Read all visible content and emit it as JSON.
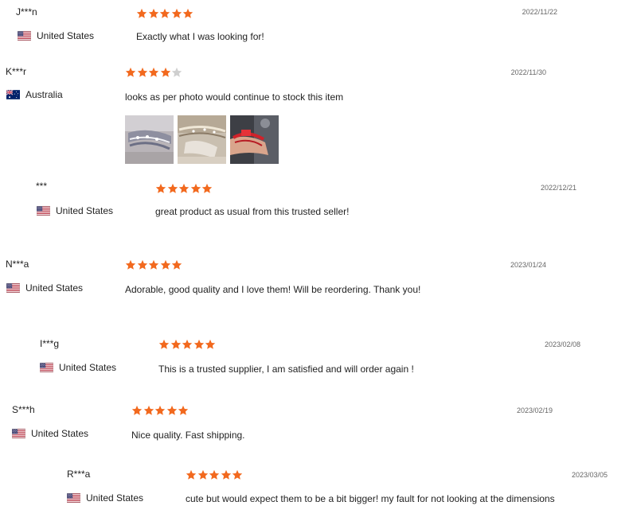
{
  "colors": {
    "star_filled": "#f2691e",
    "star_empty": "#cfcfcf",
    "date_text": "#666666"
  },
  "icons": {
    "star": "star-icon",
    "flag_us": "us-flag-icon",
    "flag_au": "australia-flag-icon"
  },
  "reviews": [
    {
      "name": "J***n",
      "country": "United States",
      "flag": "us",
      "rating": 5,
      "date": "2022/11/22",
      "text": "Exactly what I was looking for!"
    },
    {
      "name": "K***r",
      "country": "Australia",
      "flag": "au",
      "rating": 4,
      "date": "2022/11/30",
      "text": "looks as per photo would continue to stock this item",
      "photos": 3
    },
    {
      "name": "***",
      "country": "United States",
      "flag": "us",
      "rating": 5,
      "date": "2022/12/21",
      "text": "great product as usual from this trusted seller!"
    },
    {
      "name": "N***a",
      "country": "United States",
      "flag": "us",
      "rating": 5,
      "date": "2023/01/24",
      "text": "Adorable, good quality and I love them! Will be reordering. Thank you!"
    },
    {
      "name": "I***g",
      "country": "United States",
      "flag": "us",
      "rating": 5,
      "date": "2023/02/08",
      "text": "This is a trusted supplier, I am satisfied and will order again !"
    },
    {
      "name": "S***h",
      "country": "United States",
      "flag": "us",
      "rating": 5,
      "date": "2023/02/19",
      "text": "Nice quality. Fast shipping."
    },
    {
      "name": "R***a",
      "country": "United States",
      "flag": "us",
      "rating": 5,
      "date": "2023/03/05",
      "text": "cute but would expect them to be a bit bigger! my fault for not looking at the dimensions"
    }
  ]
}
